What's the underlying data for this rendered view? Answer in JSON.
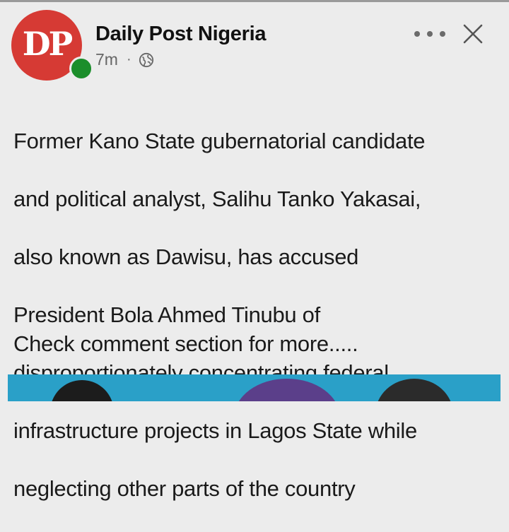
{
  "post": {
    "page_name": "Daily Post Nigeria",
    "avatar_text": "DP",
    "time": "7m",
    "separator": "·",
    "privacy_icon": "globe-icon",
    "more_icon": "more-dots-icon",
    "close_icon": "close-icon",
    "body_lines": [
      "Former Kano State gubernatorial candidate",
      "and political analyst, Salihu Tanko Yakasai,",
      "also known as Dawisu, has accused",
      "President Bola Ahmed Tinubu of",
      "disproportionately concentrating federal",
      "infrastructure projects in Lagos State while",
      "neglecting other parts of the country"
    ],
    "footer_text": "Check comment section for more....."
  },
  "colors": {
    "background": "#ececec",
    "avatar_red": "#d63a34",
    "online_green": "#1b8e2b",
    "image_teal": "#2aa0c8",
    "text": "#1a1a1a"
  }
}
